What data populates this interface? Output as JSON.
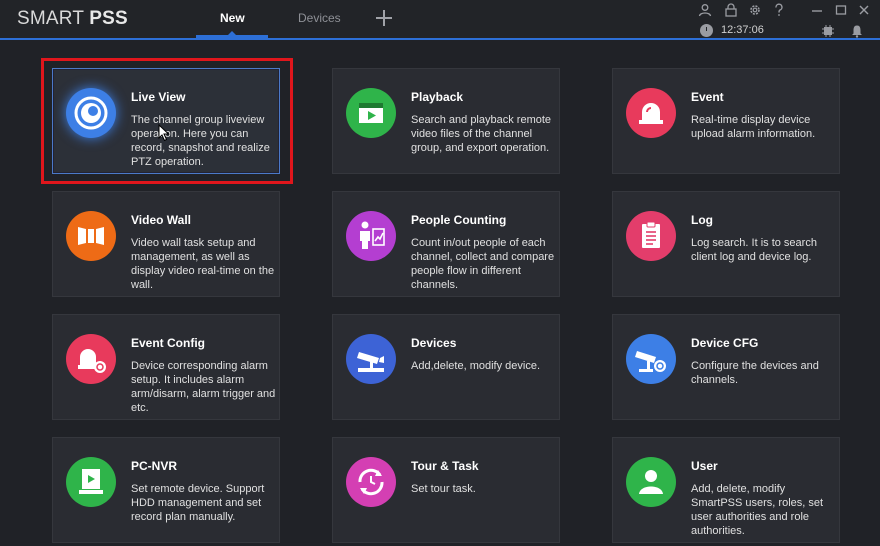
{
  "app": {
    "brand_prefix": "SMART ",
    "brand_suffix": "PSS"
  },
  "tabs": [
    {
      "label": "New",
      "active": true
    },
    {
      "label": "Devices",
      "active": false
    }
  ],
  "titlebar": {
    "time": "12:37:06",
    "icons": [
      "user-icon",
      "lock-icon",
      "settings-icon",
      "help-icon",
      "minimize-icon",
      "maximize-icon",
      "close-icon",
      "clock-icon",
      "cpu-icon",
      "bell-icon"
    ]
  },
  "cards": [
    {
      "title": "Live View",
      "desc": "The channel group liveview operation. Here you can record, snapshot and realize PTZ operation.",
      "icon": "live-view-icon",
      "color": "#3d7fe6",
      "selected": true
    },
    {
      "title": "Playback",
      "desc": "Search and playback remote video files of the channel group, and export operation.",
      "icon": "playback-icon",
      "color": "#2fb44a"
    },
    {
      "title": "Event",
      "desc": "Real-time display device upload alarm information.",
      "icon": "alarm-light-icon",
      "color": "#e83a5c"
    },
    {
      "title": "Video Wall",
      "desc": "Video wall task setup and management, as well as display video real-time on the wall.",
      "icon": "video-wall-icon",
      "color": "#ee6b16"
    },
    {
      "title": "People Counting",
      "desc": "Count in/out people of each channel, collect and compare people flow in different channels.",
      "icon": "people-counting-icon",
      "color": "#b43ed1"
    },
    {
      "title": "Log",
      "desc": "Log search. It is to search client log and device log.",
      "icon": "clipboard-icon",
      "color": "#e33d6b"
    },
    {
      "title": "Event Config",
      "desc": "Device corresponding alarm setup. It includes alarm arm/disarm, alarm trigger and etc.",
      "icon": "alarm-config-icon",
      "color": "#e83a5c"
    },
    {
      "title": "Devices",
      "desc": "Add,delete, modify device.",
      "icon": "camera-device-icon",
      "color": "#3d63d6"
    },
    {
      "title": "Device CFG",
      "desc": "Configure the devices and channels.",
      "icon": "camera-config-icon",
      "color": "#3d7fe6"
    },
    {
      "title": "PC-NVR",
      "desc": "Set remote device. Support HDD management and set record plan manually.",
      "icon": "pc-nvr-icon",
      "color": "#2fb44a"
    },
    {
      "title": "Tour & Task",
      "desc": "Set tour task.",
      "icon": "tour-task-icon",
      "color": "#d43fb3"
    },
    {
      "title": "User",
      "desc": "Add, delete, modify SmartPSS users, roles, set user authorities and role authorities.",
      "icon": "user-icon",
      "color": "#2fb44a"
    }
  ]
}
